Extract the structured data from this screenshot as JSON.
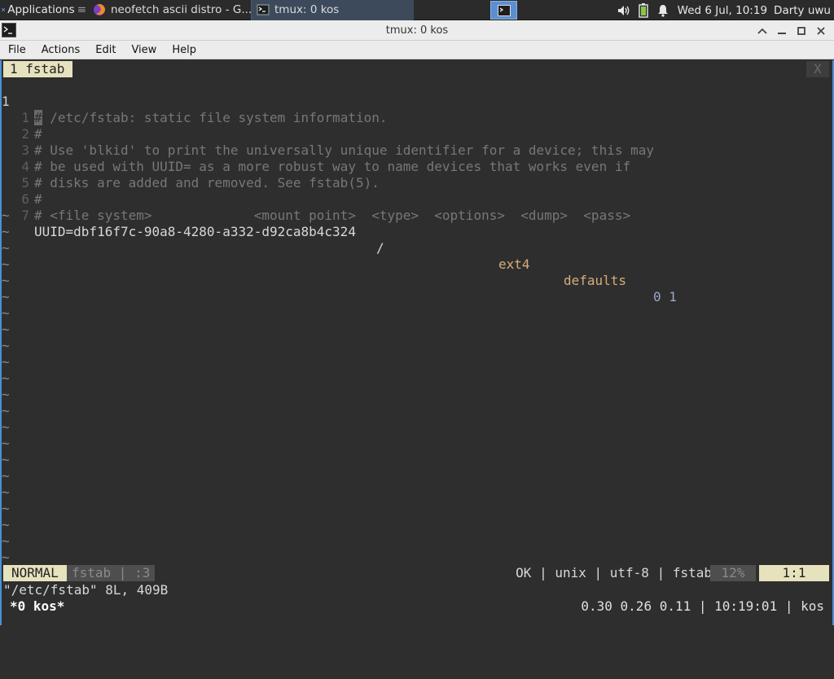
{
  "panel": {
    "applications_label": "Applications",
    "tasks": [
      {
        "title": "neofetch ascii distro - G..."
      },
      {
        "title": "tmux: 0 kos"
      }
    ],
    "clock": "Wed  6 Jul, 10:19",
    "user": "Darty uwu"
  },
  "window": {
    "title": "tmux: 0 kos"
  },
  "menu": [
    "File",
    "Actions",
    "Edit",
    "View",
    "Help"
  ],
  "tmux_tab": {
    "label": "1 fstab",
    "close": "X"
  },
  "editor": {
    "current_line_number": "1",
    "lines": [
      {
        "num": "1",
        "current": true,
        "text": "# /etc/fstab: static file system information."
      },
      {
        "num": "1",
        "text": "#"
      },
      {
        "num": "2",
        "text": "# Use 'blkid' to print the universally unique identifier for a device; this may"
      },
      {
        "num": "3",
        "text": "# be used with UUID= as a more robust way to name devices that works even if"
      },
      {
        "num": "4",
        "text": "# disks are added and removed. See fstab(5)."
      },
      {
        "num": "5",
        "text": "#"
      },
      {
        "num": "6",
        "text": "# <file system>             <mount point>  <type>  <options>  <dump>  <pass>"
      }
    ],
    "entry": {
      "num": "7",
      "uuid": "UUID=dbf16f7c-90a8-4280-a332-d92ca8b4c324",
      "mount": "/",
      "type": "ext4",
      "options": "defaults",
      "dump_pass": "0 1"
    },
    "tilde_count": 22
  },
  "statusline": {
    "mode": "NORMAL",
    "file_segment": "fstab | :3",
    "right": "OK | unix | utf-8 | fstab",
    "percent": "12%",
    "position": "1:1"
  },
  "message": "\"/etc/fstab\" 8L, 409B",
  "tmux_status": {
    "window": "*0 kos*",
    "right": "0.30 0.26 0.11 | 10:19:01 | kos"
  }
}
